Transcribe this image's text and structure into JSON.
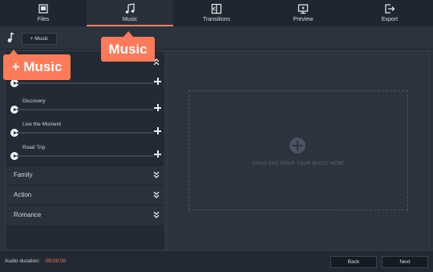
{
  "nav": {
    "tabs": [
      {
        "label": "Files",
        "icon": "files-icon"
      },
      {
        "label": "Music",
        "icon": "music-note-icon",
        "active": true
      },
      {
        "label": "Transitions",
        "icon": "transitions-icon"
      },
      {
        "label": "Preview",
        "icon": "preview-icon"
      },
      {
        "label": "Export",
        "icon": "export-icon"
      }
    ]
  },
  "toolbar": {
    "add_music_label": "+ Music"
  },
  "callouts": {
    "music": "Music",
    "add_music": "+ Music"
  },
  "library": {
    "tracks": [
      {
        "name": ""
      },
      {
        "name": "Discovery"
      },
      {
        "name": "Live the Moment"
      },
      {
        "name": "Road Trip"
      }
    ],
    "categories": [
      {
        "name": "Family"
      },
      {
        "name": "Action"
      },
      {
        "name": "Romance"
      }
    ]
  },
  "dropzone": {
    "text": "DRAG AND DROP YOUR MUSIC HERE"
  },
  "footer": {
    "duration_label": "Audio duration:",
    "duration_value": "00:00:00",
    "back_label": "Back",
    "next_label": "Next"
  },
  "colors": {
    "accent": "#ff7d5c",
    "background": "#2a323d"
  }
}
